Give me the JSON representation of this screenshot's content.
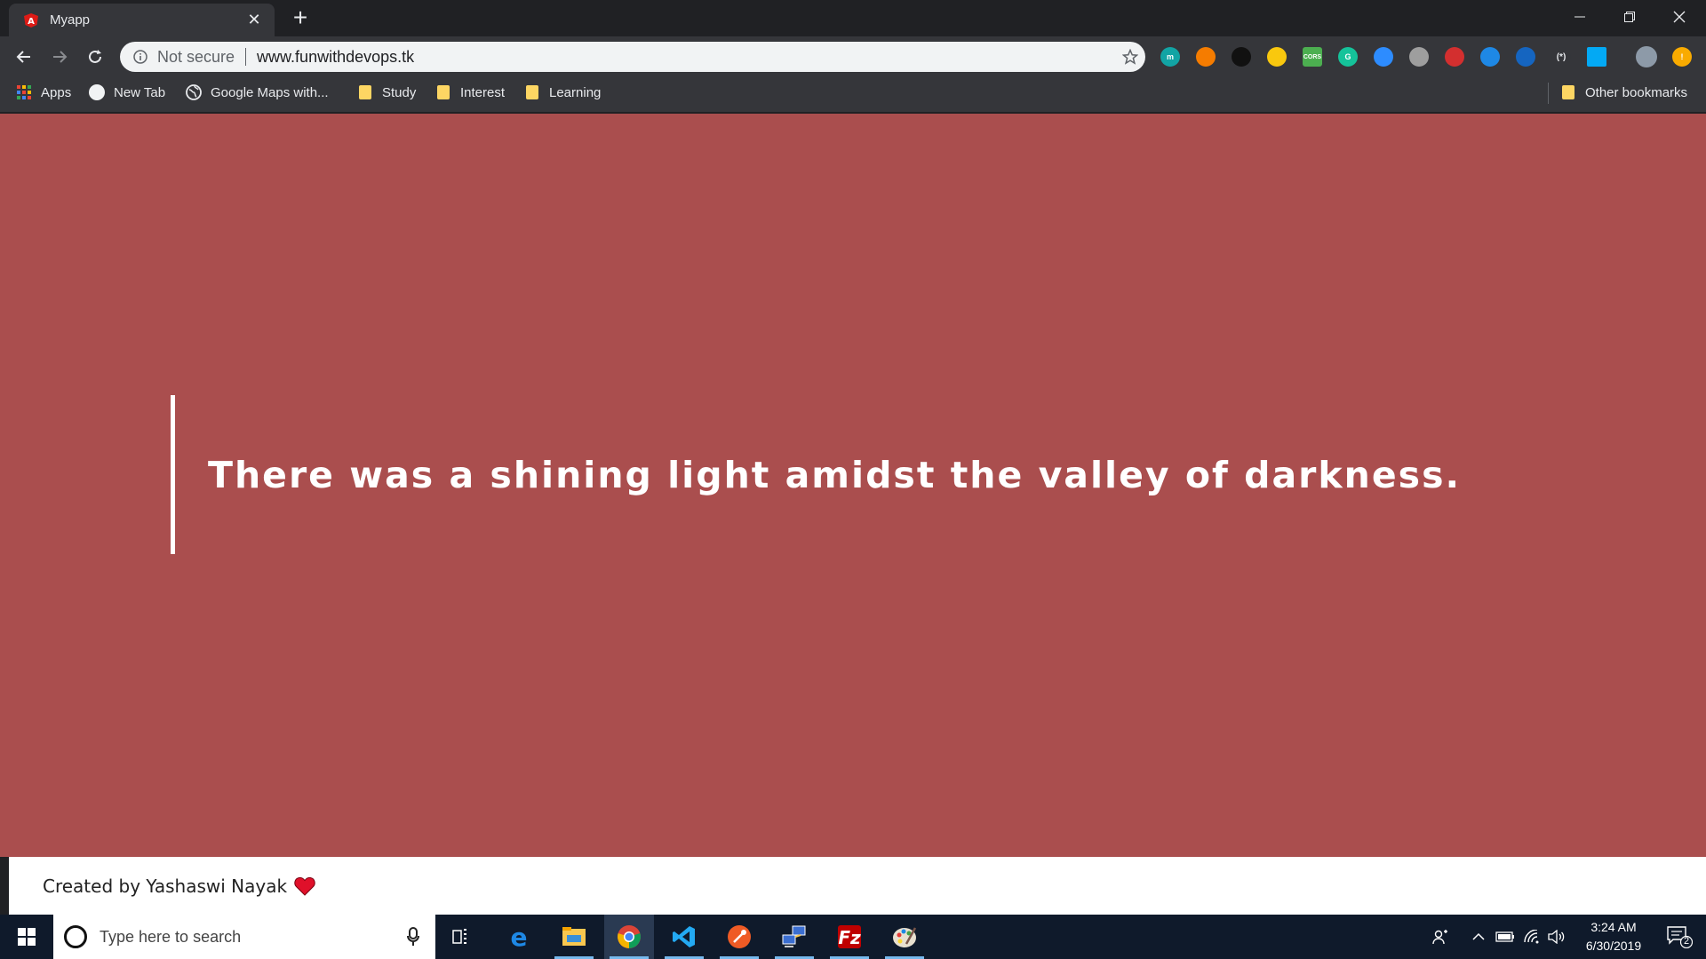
{
  "browser": {
    "tab": {
      "title": "Myapp",
      "close_glyph": "✕"
    },
    "new_tab_glyph": "+",
    "window_controls": [
      "minimize",
      "restore",
      "close"
    ],
    "address_bar": {
      "security_label": "Not secure",
      "url": "www.funwithdevops.tk"
    },
    "extensions": [
      {
        "name": "m-extension-icon",
        "color": "#12a4a4",
        "label": "m"
      },
      {
        "name": "fire-extension-icon",
        "color": "#f57c00",
        "label": ""
      },
      {
        "name": "dark-ring-extension-icon",
        "color": "#111111",
        "label": ""
      },
      {
        "name": "yellow-c-extension-icon",
        "color": "#f9c80e",
        "label": ""
      },
      {
        "name": "cors-extension-icon",
        "color": "#4caf50",
        "label": "CORS"
      },
      {
        "name": "grammarly-icon",
        "color": "#15c39a",
        "label": "G"
      },
      {
        "name": "zoom-icon",
        "color": "#2d8cff",
        "label": ""
      },
      {
        "name": "owl-extension-icon",
        "color": "#9e9e9e",
        "label": ""
      },
      {
        "name": "red-extension-icon",
        "color": "#d32f2f",
        "label": ""
      },
      {
        "name": "blue-puzzle-extension-icon",
        "color": "#1e88e5",
        "label": ""
      },
      {
        "name": "blue-square-extension-icon",
        "color": "#1565c0",
        "label": ""
      },
      {
        "name": "brackets-extension-icon",
        "color": "#35363a",
        "label": "(*)"
      },
      {
        "name": "windows-extension-icon",
        "color": "#03a9f4",
        "label": ""
      }
    ],
    "bookmarks": {
      "apps_label": "Apps",
      "items": [
        {
          "label": "New Tab"
        },
        {
          "label": "Google Maps with..."
        },
        {
          "label": "Study"
        },
        {
          "label": "Interest"
        },
        {
          "label": "Learning"
        }
      ],
      "other_label": "Other bookmarks"
    }
  },
  "page": {
    "background": "#aa4e4e",
    "quote": "There was a shining light amidst the valley of darkness.",
    "footer_text": "Created by Yashaswi Nayak"
  },
  "taskbar": {
    "search_placeholder": "Type here to search",
    "apps": [
      "task-view",
      "edge",
      "file-explorer",
      "chrome",
      "vscode",
      "postman",
      "network-tool",
      "filezilla",
      "paint"
    ],
    "clock_time": "3:24 AM",
    "clock_date": "6/30/2019",
    "notification_count": "2"
  }
}
